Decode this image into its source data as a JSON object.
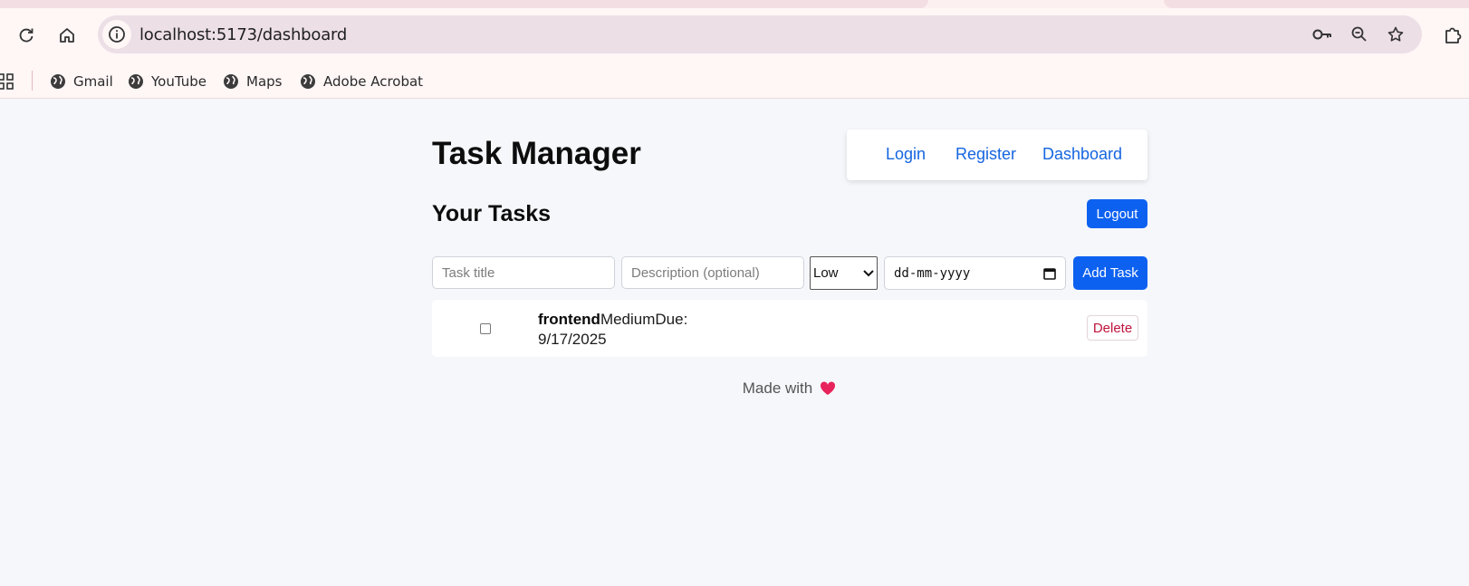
{
  "browser": {
    "url": "localhost:5173/dashboard",
    "bookmarks": [
      {
        "label": "Gmail"
      },
      {
        "label": "YouTube"
      },
      {
        "label": "Maps"
      },
      {
        "label": "Adobe Acrobat"
      }
    ]
  },
  "app": {
    "title": "Task Manager",
    "nav": {
      "login": "Login",
      "register": "Register",
      "dashboard": "Dashboard"
    },
    "section_title": "Your Tasks",
    "logout_label": "Logout",
    "form": {
      "title_placeholder": "Task title",
      "description_placeholder": "Description (optional)",
      "priority_value": "Low",
      "date_placeholder": "dd-mm-yyyy",
      "add_label": "Add Task"
    },
    "tasks": [
      {
        "title": "frontend",
        "priority": "Medium",
        "due": "Due: 9/17/2025",
        "done": false,
        "delete_label": "Delete"
      }
    ],
    "footer": {
      "text": "Made with",
      "accent": "#e8245c"
    }
  },
  "colors": {
    "primary": "#0d61f0",
    "link": "#1565e0",
    "danger": "#c0143c"
  }
}
